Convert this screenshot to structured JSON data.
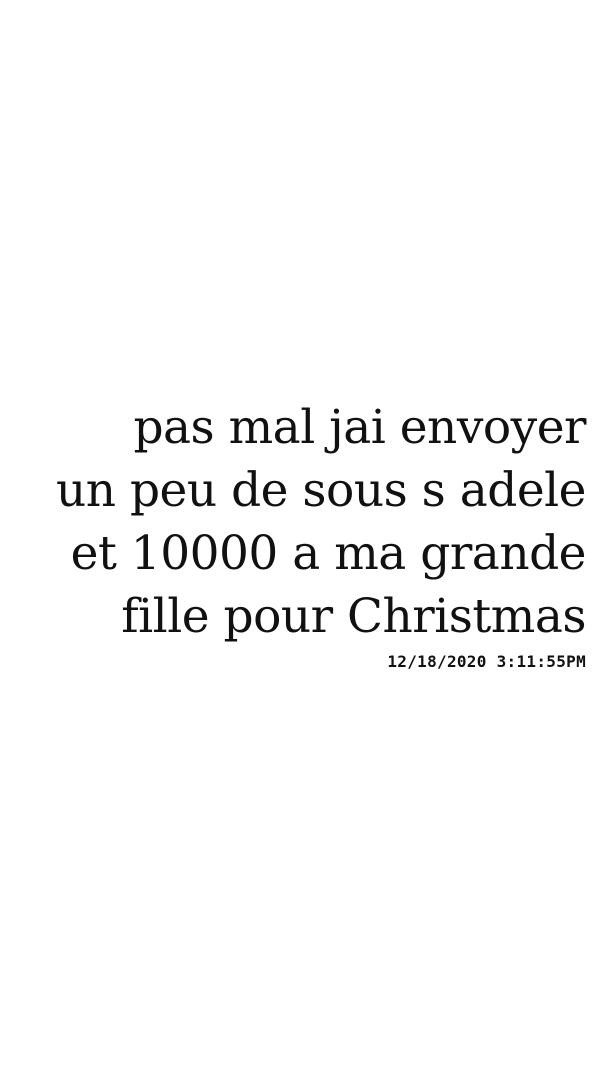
{
  "message": {
    "lines": [
      "pas mal jai envoyer",
      "un peu de sous s adele",
      "et 10000 a ma grande",
      "fille pour Christmas"
    ],
    "timestamp": "12/18/2020 3:11:55PM"
  }
}
